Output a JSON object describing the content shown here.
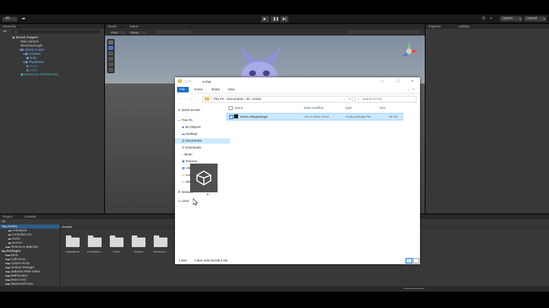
{
  "toolbar": {
    "account": "All",
    "layers": "Layers",
    "layout": "Layout"
  },
  "hierarchy": {
    "tab": "Hierarchy",
    "search_placeholder": "All",
    "items": [
      {
        "label": "Jinxed_Furgon*",
        "bold": true
      },
      {
        "label": "Main Camera"
      },
      {
        "label": "Directional Light"
      },
      {
        "label": "Jinxed_Furgon",
        "prefab": true
      },
      {
        "label": "Armature",
        "prefab": true
      },
      {
        "label": "Body",
        "prefab": true
      },
      {
        "label": "PhysBones",
        "prefab": true
      },
      {
        "label": "Props",
        "prefab": true
      },
      {
        "label": "Hand",
        "prefab": true
      },
      {
        "label": "GoGoLoco All (VRCFury)",
        "prefab": true
      }
    ]
  },
  "scene": {
    "tab_scene": "Scene",
    "tab_game": "Game",
    "pivot": "Pivot",
    "global": "Global"
  },
  "inspector": {
    "tab_inspector": "Inspector",
    "tab_lighting": "Lighting"
  },
  "project": {
    "tab_project": "Project",
    "tab_console": "Console",
    "favorites_root": "Assets",
    "assets_children": [
      "Animations",
      "Controllers.etc",
      "GoGo",
      "Scenes",
      "Textures & Materials"
    ],
    "packages_root": "Packages",
    "packages_children": [
      "Burst",
      "Collections",
      "Custom NUnit",
      "Gesture Manager",
      "JetBrains Rider Editor",
      "Mathematics",
      "Mono Cecil",
      "Newtonsoft Json"
    ],
    "breadcrumb": "Assets",
    "grid_folders": [
      "Animations",
      "Controllers...",
      "GoGo",
      "Scenes",
      "Textures &..."
    ]
  },
  "explorer": {
    "title": "vrchat",
    "ribbon_tabs": [
      "File",
      "Home",
      "Share",
      "View"
    ],
    "path": [
      "This PC",
      "Documents",
      "3d",
      "vrchat"
    ],
    "search_placeholder": "Search vrchat",
    "columns": [
      "Name",
      "Date modified",
      "Type",
      "Size"
    ],
    "file": {
      "name": "socks.unitypackage",
      "date": "25.11.2024 13:54",
      "type": "Unity package file",
      "size": "89 KB"
    },
    "nav": [
      "Quick access",
      "This PC",
      "3D Objects",
      "Desktop",
      "Documents",
      "Downloads",
      "Music",
      "Pictures",
      "Videos",
      "Local Disk",
      "New Volume",
      "Network",
      "Linux"
    ],
    "status_items": "1 item",
    "status_selected": "1 item selected  89,2 KB"
  },
  "colors": {
    "unity_dark": "#383838",
    "unity_header": "#282828",
    "scene_bg": "#474747",
    "explorer_accent": "#1a6fc9",
    "selection": "#cce8ff",
    "prefab_text": "#7fb6ff"
  }
}
